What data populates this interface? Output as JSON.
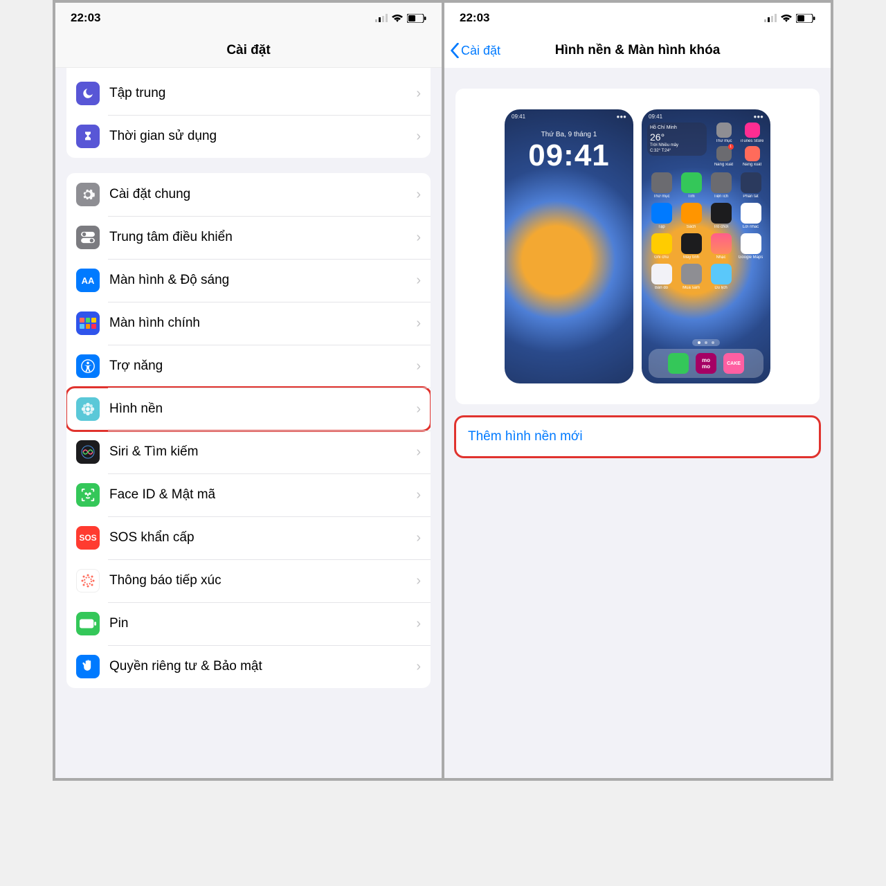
{
  "statusbar": {
    "time": "22:03"
  },
  "left": {
    "title": "Cài đặt",
    "group1": [
      {
        "label": "Tập trung",
        "icon": "moon",
        "color": "bg-purple"
      },
      {
        "label": "Thời gian sử dụng",
        "icon": "hourglass",
        "color": "bg-purple"
      }
    ],
    "group2": [
      {
        "label": "Cài đặt chung",
        "icon": "gear",
        "color": "bg-gray"
      },
      {
        "label": "Trung tâm điều khiển",
        "icon": "toggles",
        "color": "bg-darkgray"
      },
      {
        "label": "Màn hình & Độ sáng",
        "icon": "AA",
        "color": "bg-blue"
      },
      {
        "label": "Màn hình chính",
        "icon": "grid",
        "color": "bg-bluegrid"
      },
      {
        "label": "Trợ năng",
        "icon": "accessibility",
        "color": "bg-blue"
      },
      {
        "label": "Hình nền",
        "icon": "flower",
        "color": "bg-teal",
        "highlight": true
      },
      {
        "label": "Siri & Tìm kiếm",
        "icon": "siri",
        "color": "bg-black"
      },
      {
        "label": "Face ID & Mật mã",
        "icon": "faceid",
        "color": "bg-green"
      },
      {
        "label": "SOS khẩn cấp",
        "icon": "SOS",
        "color": "bg-red"
      },
      {
        "label": "Thông báo tiếp xúc",
        "icon": "virus",
        "color": "bg-white"
      },
      {
        "label": "Pin",
        "icon": "battery",
        "color": "bg-green"
      },
      {
        "label": "Quyền riêng tư & Bảo mật",
        "icon": "hand",
        "color": "bg-blue"
      }
    ]
  },
  "right": {
    "back": "Cài đặt",
    "title": "Hình nền & Màn hình khóa",
    "addNew": "Thêm hình nền mới",
    "lock": {
      "statusTime": "09:41",
      "date": "Thứ Ba, 9 tháng 1",
      "time": "09:41"
    },
    "home": {
      "statusTime": "09:41",
      "weather": {
        "city": "Hồ Chí Minh",
        "temp": "26°",
        "cond": "Trời Nhiều mây",
        "range": "C:32° T:24°"
      },
      "apps": [
        "Thư mục",
        "iTunes Store",
        "Năng xuất",
        "Năng xuất",
        "Thứ mục",
        "Tìm",
        "Tiện ích",
        "Phần tắt",
        "Tập",
        "Sách",
        "Trò chơi",
        "Lời nhắc",
        "Ghi chú",
        "Máy tính",
        "Nhạc",
        "Google Maps",
        "Bản đồ",
        "Mua sắm",
        "Du lịch",
        ""
      ]
    }
  }
}
